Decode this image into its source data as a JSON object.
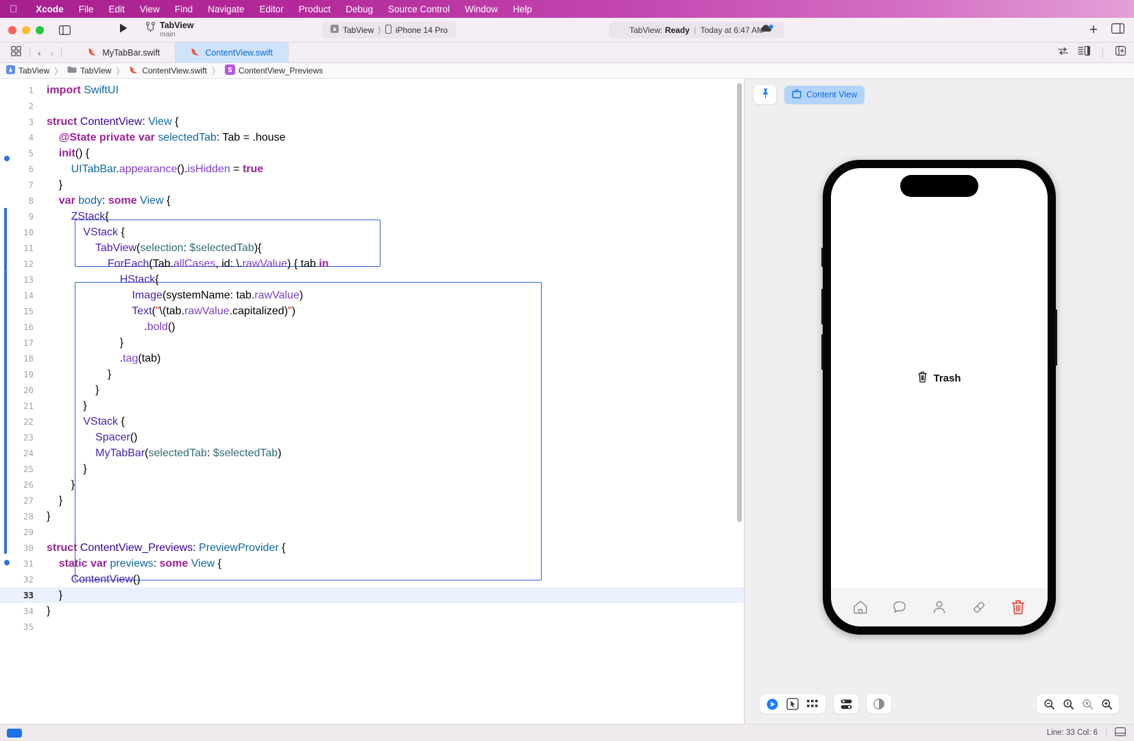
{
  "menubar": {
    "apple_icon": "apple-logo-icon",
    "items": [
      {
        "label": "Xcode",
        "bold": true
      },
      {
        "label": "File",
        "bold": false
      },
      {
        "label": "Edit",
        "bold": false
      },
      {
        "label": "View",
        "bold": false
      },
      {
        "label": "Find",
        "bold": false
      },
      {
        "label": "Navigate",
        "bold": false
      },
      {
        "label": "Editor",
        "bold": false
      },
      {
        "label": "Product",
        "bold": false
      },
      {
        "label": "Debug",
        "bold": false
      },
      {
        "label": "Source Control",
        "bold": false
      },
      {
        "label": "Window",
        "bold": false
      },
      {
        "label": "Help",
        "bold": false
      }
    ]
  },
  "toolbar": {
    "scheme_name": "TabView",
    "scheme_branch": "main",
    "destination_project": "TabView",
    "destination_device": "iPhone 14 Pro",
    "status_project": "TabView:",
    "status_state": "Ready",
    "status_time": "Today at 6:47 AM",
    "run_icon": "play-icon",
    "branch_icon": "branch-icon",
    "add_label": "+",
    "inspector_icon": "right-panel-icon",
    "sidebar_icon": "left-panel-icon",
    "cloud_icon": "cloud-status-icon"
  },
  "tabbar": {
    "grid_icon": "tab-grid-icon",
    "back_icon": "chevron-left-icon",
    "forward_icon": "chevron-right-icon",
    "tabs": [
      {
        "label": "MyTabBar.swift",
        "active": false,
        "icon": "swift-file-icon"
      },
      {
        "label": "ContentView.swift",
        "active": true,
        "icon": "swift-file-icon"
      }
    ],
    "right_icons": [
      "swap-editor-icon",
      "minimap-icon",
      "add-editor-icon"
    ]
  },
  "breadcrumb": {
    "items": [
      {
        "label": "TabView",
        "icon": "project-icon"
      },
      {
        "label": "TabView",
        "icon": "folder-icon"
      },
      {
        "label": "ContentView.swift",
        "icon": "swift-file-icon"
      },
      {
        "label": "ContentView_Previews",
        "icon": "struct-symbol-icon"
      }
    ],
    "separator": "〉"
  },
  "editor": {
    "total_lines": 35,
    "current_line": 33,
    "lines": [
      {
        "n": 1,
        "text": "import SwiftUI"
      },
      {
        "n": 2,
        "text": ""
      },
      {
        "n": 3,
        "text": "struct ContentView: View {"
      },
      {
        "n": 4,
        "text": "    @State private var selectedTab: Tab = .house"
      },
      {
        "n": 5,
        "text": "    init() {"
      },
      {
        "n": 6,
        "text": "        UITabBar.appearance().isHidden = true"
      },
      {
        "n": 7,
        "text": "    }"
      },
      {
        "n": 8,
        "text": "    var body: some View {"
      },
      {
        "n": 9,
        "text": "        ZStack{"
      },
      {
        "n": 10,
        "text": "            VStack {"
      },
      {
        "n": 11,
        "text": "                TabView(selection: $selectedTab){"
      },
      {
        "n": 12,
        "text": "                    ForEach(Tab.allCases, id: \\.rawValue) { tab in"
      },
      {
        "n": 13,
        "text": "                        HStack{"
      },
      {
        "n": 14,
        "text": "                            Image(systemName: tab.rawValue)"
      },
      {
        "n": 15,
        "text": "                            Text(\"\\(tab.rawValue.capitalized)\")"
      },
      {
        "n": 16,
        "text": "                                .bold()"
      },
      {
        "n": 17,
        "text": "                        }"
      },
      {
        "n": 18,
        "text": "                        .tag(tab)"
      },
      {
        "n": 19,
        "text": "                    }"
      },
      {
        "n": 20,
        "text": "                }"
      },
      {
        "n": 21,
        "text": "            }"
      },
      {
        "n": 22,
        "text": "            VStack {"
      },
      {
        "n": 23,
        "text": "                Spacer()"
      },
      {
        "n": 24,
        "text": "                MyTabBar(selectedTab: $selectedTab)"
      },
      {
        "n": 25,
        "text": "            }"
      },
      {
        "n": 26,
        "text": "        }"
      },
      {
        "n": 27,
        "text": "    }"
      },
      {
        "n": 28,
        "text": "}"
      },
      {
        "n": 29,
        "text": ""
      },
      {
        "n": 30,
        "text": "struct ContentView_Previews: PreviewProvider {"
      },
      {
        "n": 31,
        "text": "    static var previews: some View {"
      },
      {
        "n": 32,
        "text": "        ContentView()"
      },
      {
        "n": 33,
        "text": "    }"
      },
      {
        "n": 34,
        "text": "}"
      },
      {
        "n": 35,
        "text": ""
      }
    ]
  },
  "canvas": {
    "pin_icon": "pin-icon",
    "preview_chip_label": "Content View",
    "preview_chip_icon": "preview-box-icon",
    "device_name": "iPhone 14 Pro",
    "preview_center_label": "Trash",
    "preview_center_icon": "trash-icon",
    "phone_tabs": [
      {
        "icon": "house-icon",
        "selected": false
      },
      {
        "icon": "message-icon",
        "selected": false
      },
      {
        "icon": "person-icon",
        "selected": false
      },
      {
        "icon": "eraser-icon",
        "selected": false
      },
      {
        "icon": "trash-icon",
        "selected": true
      }
    ],
    "selected_tab_color": "#e8382a",
    "controls": [
      {
        "name": "live-preview-button",
        "icon": "play-circle-icon"
      },
      {
        "name": "selectable-preview-button",
        "icon": "cursor-box-icon"
      },
      {
        "name": "variants-button",
        "icon": "variants-grid-icon"
      },
      {
        "name": "device-settings-button",
        "icon": "device-settings-icon"
      },
      {
        "name": "color-scheme-button",
        "icon": "color-scheme-icon"
      }
    ],
    "zoom_controls": [
      {
        "name": "zoom-out-button",
        "icon": "magnifier-minus-icon"
      },
      {
        "name": "zoom-to-fit-button",
        "icon": "magnifier-fit-icon"
      },
      {
        "name": "zoom-100-button",
        "icon": "magnifier-100-icon"
      },
      {
        "name": "zoom-in-button",
        "icon": "magnifier-plus-icon"
      }
    ]
  },
  "statusbar": {
    "line_col": "Line: 33  Col: 6",
    "jump_icon": "jump-bar-icon",
    "minimize_icon": "hide-debug-icon"
  },
  "colors": {
    "accent_blue": "#2a5bd7",
    "tab_active_bg": "#cfe4fb",
    "tab_active_text": "#0a66d6",
    "menubar_magenta": "#b3289a",
    "selected_tab_red": "#e8382a"
  }
}
